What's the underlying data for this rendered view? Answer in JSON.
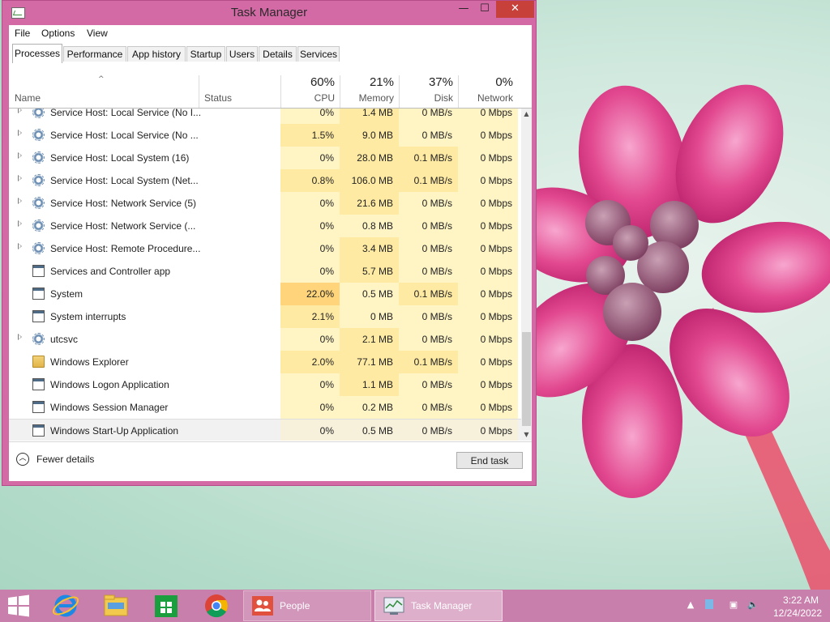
{
  "window": {
    "title": "Task Manager",
    "controls": {
      "minimize": "—",
      "maximize": "☐",
      "close": "✕"
    }
  },
  "menu": [
    "File",
    "Options",
    "View"
  ],
  "tabs": [
    {
      "label": "Processes",
      "active": true
    },
    {
      "label": "Performance"
    },
    {
      "label": "App history"
    },
    {
      "label": "Startup"
    },
    {
      "label": "Users"
    },
    {
      "label": "Details"
    },
    {
      "label": "Services"
    }
  ],
  "header": {
    "sort_indicator": "^",
    "name": "Name",
    "status": "Status",
    "cpu": {
      "pct": "60%",
      "label": "CPU"
    },
    "memory": {
      "pct": "21%",
      "label": "Memory"
    },
    "disk": {
      "pct": "37%",
      "label": "Disk"
    },
    "network": {
      "pct": "0%",
      "label": "Network"
    }
  },
  "heat_colors": {
    "light": "#fff4c4",
    "mid": "#ffeaa3",
    "high": "#ffd47a",
    "none": "#ffffff"
  },
  "rows": [
    {
      "name": "Service Host: Local Service (No I...",
      "icon": "gear-icon",
      "expandable": true,
      "cpu": "0%",
      "memory": "1.4 MB",
      "disk": "0 MB/s",
      "network": "0 Mbps"
    },
    {
      "name": "Service Host: Local Service (No ...",
      "icon": "gear-icon",
      "expandable": true,
      "cpu": "1.5%",
      "memory": "9.0 MB",
      "disk": "0 MB/s",
      "network": "0 Mbps"
    },
    {
      "name": "Service Host: Local System (16)",
      "icon": "gear-icon",
      "expandable": true,
      "cpu": "0%",
      "memory": "28.0 MB",
      "disk": "0.1 MB/s",
      "network": "0 Mbps"
    },
    {
      "name": "Service Host: Local System (Net...",
      "icon": "gear-icon",
      "expandable": true,
      "cpu": "0.8%",
      "memory": "106.0 MB",
      "disk": "0.1 MB/s",
      "network": "0 Mbps"
    },
    {
      "name": "Service Host: Network Service (5)",
      "icon": "gear-icon",
      "expandable": true,
      "cpu": "0%",
      "memory": "21.6 MB",
      "disk": "0 MB/s",
      "network": "0 Mbps"
    },
    {
      "name": "Service Host: Network Service (...",
      "icon": "gear-icon",
      "expandable": true,
      "cpu": "0%",
      "memory": "0.8 MB",
      "disk": "0 MB/s",
      "network": "0 Mbps"
    },
    {
      "name": "Service Host: Remote Procedure...",
      "icon": "gear-icon",
      "expandable": true,
      "cpu": "0%",
      "memory": "3.4 MB",
      "disk": "0 MB/s",
      "network": "0 Mbps"
    },
    {
      "name": "Services and Controller app",
      "icon": "window-icon",
      "expandable": false,
      "cpu": "0%",
      "memory": "5.7 MB",
      "disk": "0 MB/s",
      "network": "0 Mbps"
    },
    {
      "name": "System",
      "icon": "window-icon",
      "expandable": false,
      "cpu": "22.0%",
      "memory": "0.5 MB",
      "disk": "0.1 MB/s",
      "network": "0 Mbps",
      "cpu_high": true
    },
    {
      "name": "System interrupts",
      "icon": "window-icon",
      "expandable": false,
      "cpu": "2.1%",
      "memory": "0 MB",
      "disk": "0 MB/s",
      "network": "0 Mbps"
    },
    {
      "name": "utcsvc",
      "icon": "gear-icon",
      "expandable": true,
      "cpu": "0%",
      "memory": "2.1 MB",
      "disk": "0 MB/s",
      "network": "0 Mbps"
    },
    {
      "name": "Windows Explorer",
      "icon": "folder-icon",
      "expandable": false,
      "cpu": "2.0%",
      "memory": "77.1 MB",
      "disk": "0.1 MB/s",
      "network": "0 Mbps"
    },
    {
      "name": "Windows Logon Application",
      "icon": "window-icon",
      "expandable": false,
      "cpu": "0%",
      "memory": "1.1 MB",
      "disk": "0 MB/s",
      "network": "0 Mbps"
    },
    {
      "name": "Windows Session Manager",
      "icon": "window-icon",
      "expandable": false,
      "cpu": "0%",
      "memory": "0.2 MB",
      "disk": "0 MB/s",
      "network": "0 Mbps"
    },
    {
      "name": "Windows Start-Up Application",
      "icon": "window-icon",
      "expandable": false,
      "cpu": "0%",
      "memory": "0.5 MB",
      "disk": "0 MB/s",
      "network": "0 Mbps",
      "selected": true
    }
  ],
  "footer": {
    "fewer_details": "Fewer details",
    "end_task": "End task"
  },
  "taskbar": {
    "pinned": [
      "start-icon",
      "internet-explorer-icon",
      "file-explorer-icon",
      "store-icon",
      "chrome-icon"
    ],
    "tasks": [
      {
        "label": "People",
        "icon": "people-icon",
        "active": false
      },
      {
        "label": "Task Manager",
        "icon": "task-manager-icon",
        "active": true
      }
    ],
    "clock": {
      "time": "3:22 AM",
      "date": "12/24/2022"
    }
  }
}
